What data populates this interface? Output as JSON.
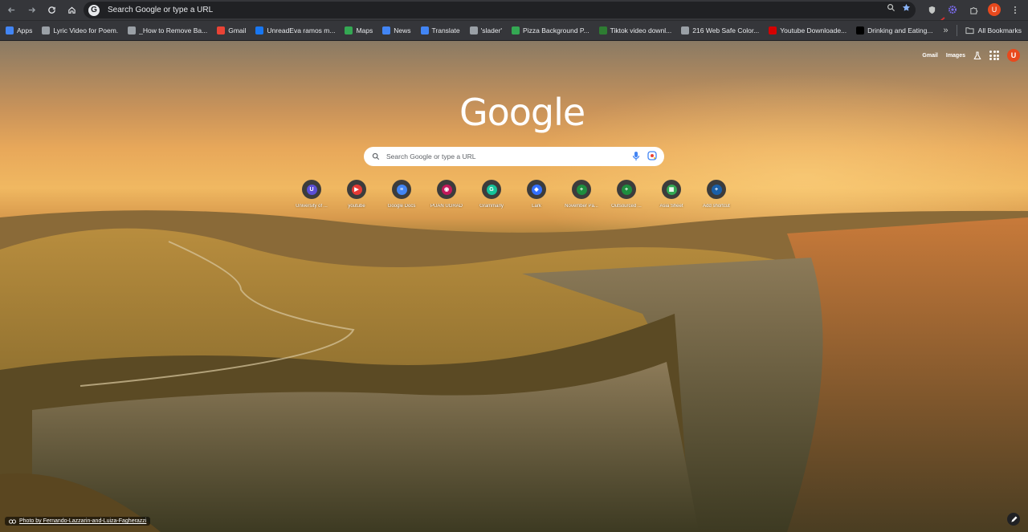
{
  "toolbar": {
    "omnibox_text": "Search Google or type a URL",
    "avatar_letter": "U"
  },
  "bookmarks": {
    "items": [
      {
        "label": "Apps",
        "color": "#4285f4"
      },
      {
        "label": "Lyric Video for Poem.",
        "color": "#9aa0a6"
      },
      {
        "label": "_How to Remove Ba...",
        "color": "#9aa0a6"
      },
      {
        "label": "Gmail",
        "color": "#ea4335"
      },
      {
        "label": "UnreadEva ramos m...",
        "color": "#1877f2"
      },
      {
        "label": "Maps",
        "color": "#34a853"
      },
      {
        "label": "News",
        "color": "#4285f4"
      },
      {
        "label": "Translate",
        "color": "#4285f4"
      },
      {
        "label": "'slader'",
        "color": "#9aa0a6"
      },
      {
        "label": "Pizza Background P...",
        "color": "#34a853"
      },
      {
        "label": "Tiktok video downl...",
        "color": "#2e7d32"
      },
      {
        "label": "216 Web Safe Color...",
        "color": "#9aa0a6"
      },
      {
        "label": "Youtube Downloade...",
        "color": "#d50000"
      },
      {
        "label": "Drinking and Eating...",
        "color": "#000000"
      }
    ],
    "overflow": "»",
    "all_bookmarks": "All Bookmarks"
  },
  "ntp": {
    "gmail": "Gmail",
    "images": "Images",
    "avatar_letter": "U",
    "logo": "Google",
    "search_placeholder": "Search Google or type a URL",
    "shortcuts": [
      {
        "label": "University of ...",
        "color": "#5b4fd6",
        "glyph": "U"
      },
      {
        "label": "youtube",
        "color": "#e53935",
        "glyph": "▶"
      },
      {
        "label": "Google Docs",
        "color": "#4285f4",
        "glyph": "≡"
      },
      {
        "label": "PUAN UGRAD",
        "color": "#c2185b",
        "glyph": "◉"
      },
      {
        "label": "Grammarly",
        "color": "#15c39a",
        "glyph": "G"
      },
      {
        "label": "Lark",
        "color": "#3370ff",
        "glyph": "◆"
      },
      {
        "label": "November Pa...",
        "color": "#1e8e3e",
        "glyph": "+"
      },
      {
        "label": "Outsourced ...",
        "color": "#1e8e3e",
        "glyph": "+"
      },
      {
        "label": "Asia Sheet",
        "color": "#34a853",
        "glyph": "▦"
      },
      {
        "label": "Add shortcut",
        "color": "#1a5fa8",
        "glyph": "+"
      }
    ],
    "attribution": "Photo by Fernando-Lazzarin-and-Luiza-Fagherazzi"
  }
}
